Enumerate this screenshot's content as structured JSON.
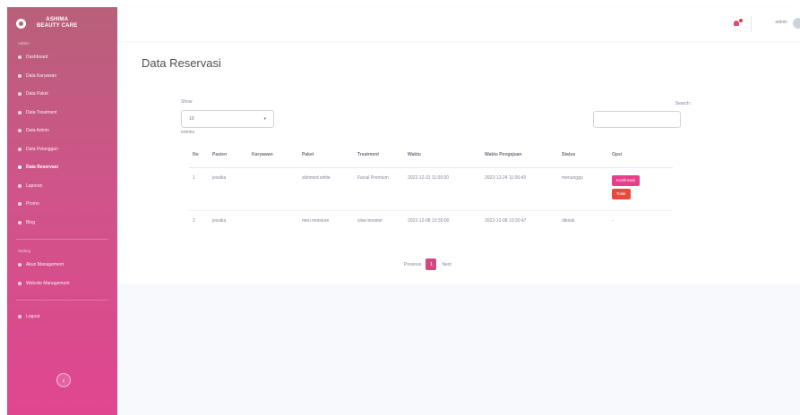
{
  "brand": {
    "line1": "ASHIMA",
    "line2": "BEAUTY CARE"
  },
  "sidebar": {
    "heading1": "Admin",
    "items": [
      {
        "label": "Dashboard"
      },
      {
        "label": "Data Karyawan"
      },
      {
        "label": "Data Paket"
      },
      {
        "label": "Data Treatment"
      },
      {
        "label": "Data Admin"
      },
      {
        "label": "Data Pelanggan"
      },
      {
        "label": "Data Reservasi"
      },
      {
        "label": "Laporan"
      },
      {
        "label": "Promo"
      },
      {
        "label": "Blog"
      }
    ],
    "heading2": "Setting",
    "settings": [
      {
        "label": "Akun Management"
      },
      {
        "label": "Website Management"
      }
    ],
    "logout": "Logout"
  },
  "topbar": {
    "user": "admin"
  },
  "page": {
    "title": "Data Reservasi"
  },
  "table_controls": {
    "show_label": "Show",
    "entries_value": "10",
    "entries_label": "entries",
    "search_label": "Search:"
  },
  "table": {
    "headers": [
      "No",
      "Pasien",
      "Karyawan",
      "Paket",
      "Treatment",
      "Waktu",
      "Waktu Pengajuan",
      "Status",
      "Opsi"
    ],
    "rows": [
      {
        "no": "1",
        "pasien": "jessika",
        "karyawan": "",
        "paket": "skinmed white",
        "treatment": "Facial Premium",
        "waktu": "2022-12-31 11:00:00",
        "waktu_pengajuan": "2022-12-24 11:06:43",
        "status": "menunggu",
        "actions": [
          "Konfirmasi",
          "Tolak"
        ]
      },
      {
        "no": "2",
        "pasien": "jessika",
        "karyawan": "",
        "paket": "meu moisture",
        "treatment": "slow booster",
        "waktu": "2022-12-08 10:30:00",
        "waktu_pengajuan": "2022-12-08 10:30:47",
        "status": "ditolak",
        "actions": [
          "-"
        ]
      }
    ]
  },
  "pagination": {
    "previous": "Previous",
    "current": "1",
    "next": "Next"
  },
  "colors": {
    "sidebar_top": "#b8607a",
    "sidebar_bottom": "#e0468f",
    "accent": "#e83e8c",
    "danger": "#e74a3b"
  }
}
